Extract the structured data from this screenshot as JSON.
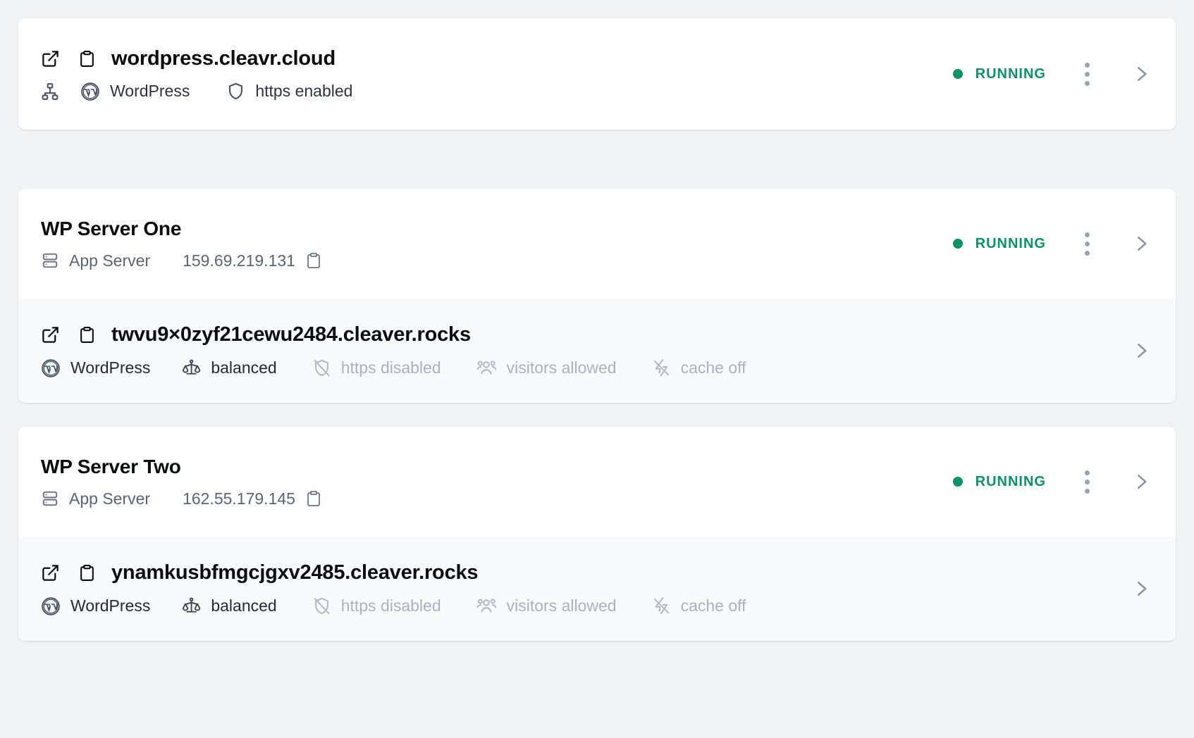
{
  "theme": {
    "page_bg": "#f1f2f4",
    "card_bg": "#ffffff",
    "site_row_bg": "#f7f9fb",
    "status_green": "#0a9268",
    "title_color": "#0b0c0e",
    "meta_color": "#5a6478",
    "muted_color": "#aab2c0"
  },
  "cards": [
    {
      "type": "site-only",
      "site": {
        "open_icon": "external-link-icon",
        "copy_icon": "clipboard-icon",
        "domain": "wordpress.cleavr.cloud",
        "meta": [
          {
            "icon": "sitemap-icon",
            "label": ""
          },
          {
            "icon": "wordpress-icon",
            "label": "WordPress",
            "tone": "dark"
          },
          {
            "icon": "shield-icon",
            "label": "https enabled",
            "tone": "dark"
          }
        ],
        "status": "RUNNING",
        "kebab_icon": "kebab-menu-icon",
        "chevron_icon": "chevron-right-icon"
      }
    },
    {
      "type": "server-with-site",
      "server": {
        "name": "WP Server One",
        "role_icon": "server-icon",
        "role": "App Server",
        "ip": "159.69.219.131",
        "copy_icon": "clipboard-icon",
        "status": "RUNNING",
        "kebab_icon": "kebab-menu-icon",
        "chevron_icon": "chevron-right-icon"
      },
      "site": {
        "open_icon": "external-link-icon",
        "copy_icon": "clipboard-icon",
        "domain": "twvu9×0zyf21cewu2484.cleaver.rocks",
        "meta": [
          {
            "icon": "wordpress-icon",
            "label": "WordPress",
            "tone": "dark"
          },
          {
            "icon": "scale-icon",
            "label": "balanced",
            "tone": "dark"
          },
          {
            "icon": "shield-off-icon",
            "label": "https disabled",
            "tone": "muted"
          },
          {
            "icon": "users-icon",
            "label": "visitors allowed",
            "tone": "muted"
          },
          {
            "icon": "zap-off-icon",
            "label": "cache off",
            "tone": "muted"
          }
        ],
        "chevron_icon": "chevron-right-icon"
      }
    },
    {
      "type": "server-with-site",
      "server": {
        "name": "WP Server Two",
        "role_icon": "server-icon",
        "role": "App Server",
        "ip": "162.55.179.145",
        "copy_icon": "clipboard-icon",
        "status": "RUNNING",
        "kebab_icon": "kebab-menu-icon",
        "chevron_icon": "chevron-right-icon"
      },
      "site": {
        "open_icon": "external-link-icon",
        "copy_icon": "clipboard-icon",
        "domain": "ynamkusbfmgcjgxv2485.cleaver.rocks",
        "meta": [
          {
            "icon": "wordpress-icon",
            "label": "WordPress",
            "tone": "dark"
          },
          {
            "icon": "scale-icon",
            "label": "balanced",
            "tone": "dark"
          },
          {
            "icon": "shield-off-icon",
            "label": "https disabled",
            "tone": "muted"
          },
          {
            "icon": "users-icon",
            "label": "visitors allowed",
            "tone": "muted"
          },
          {
            "icon": "zap-off-icon",
            "label": "cache off",
            "tone": "muted"
          }
        ],
        "chevron_icon": "chevron-right-icon"
      }
    }
  ]
}
